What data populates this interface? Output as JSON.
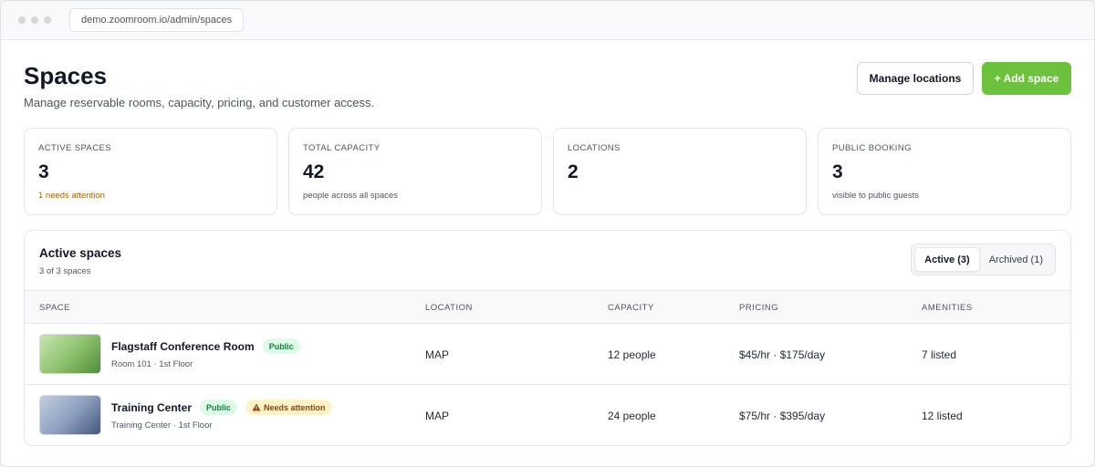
{
  "browser": {
    "url": "demo.zoomroom.io/admin/spaces"
  },
  "page": {
    "title": "Spaces",
    "subtitle": "Manage reservable rooms, capacity, pricing, and customer access.",
    "manage_locations_label": "Manage locations",
    "add_space_label": "+ Add space"
  },
  "stats": [
    {
      "label": "Active spaces",
      "value": "3",
      "note": "1 needs attention"
    },
    {
      "label": "Total capacity",
      "value": "42",
      "note": "people across all spaces"
    },
    {
      "label": "Locations",
      "value": "2",
      "note": ""
    },
    {
      "label": "Public booking",
      "value": "3",
      "note": "visible to public guests"
    }
  ],
  "panel": {
    "title": "Active spaces",
    "subtitle": "3 of 3 spaces",
    "tabs": [
      "Active (3)",
      "Archived (1)"
    ],
    "columns": [
      "Space",
      "Location",
      "Capacity",
      "Pricing",
      "Amenities"
    ],
    "rows": [
      {
        "name": "Flagstaff Conference Room",
        "badges": [
          "Public"
        ],
        "sub": "Room 101 · 1st Floor",
        "location": "MAP",
        "capacity": "12 people",
        "pricing": "$45/hr · $175/day",
        "amenities": "7 listed"
      },
      {
        "name": "Training Center",
        "badges": [
          "Public",
          "Needs attention"
        ],
        "sub": "Training Center · 1st Floor",
        "location": "MAP",
        "capacity": "24 people",
        "pricing": "$75/hr · $395/day",
        "amenities": "12 listed"
      }
    ]
  },
  "colors": {
    "primary": "#6cc23d",
    "public_badge_bg": "#dcfce7",
    "public_badge_text": "#15803d",
    "warn_badge_bg": "#fef3c7",
    "warn_badge_text": "#92400e",
    "warn_text": "#a16207"
  },
  "icons": {
    "warning": "warning-icon"
  }
}
